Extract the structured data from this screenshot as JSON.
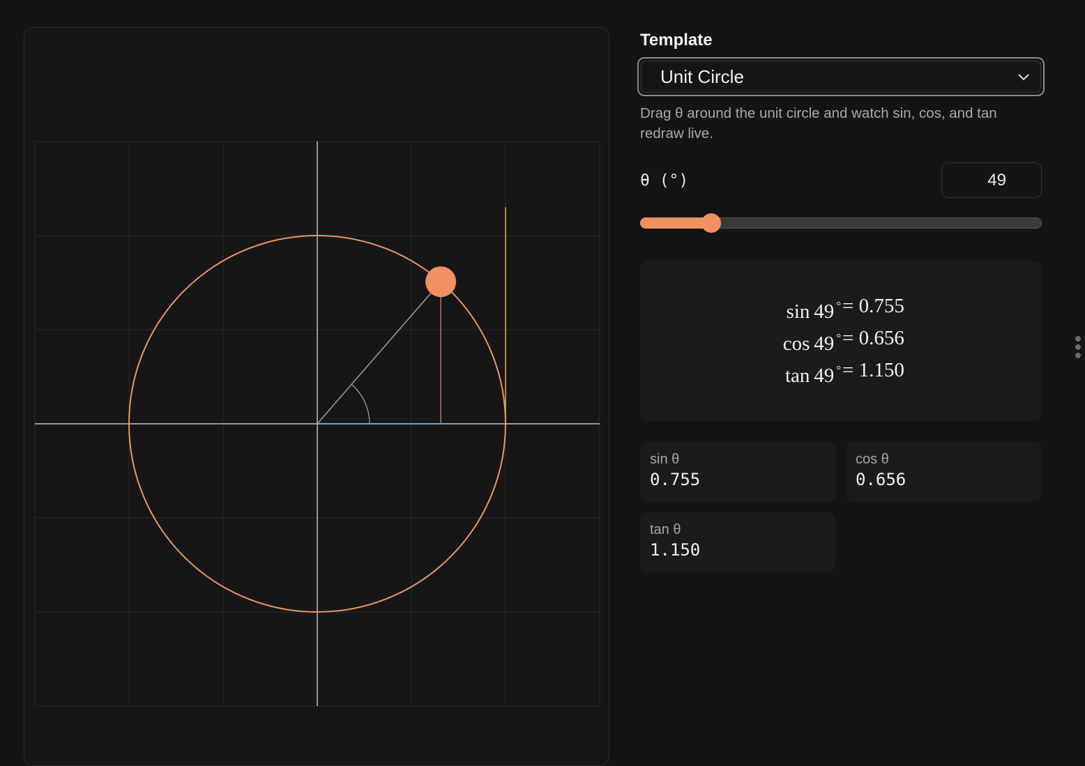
{
  "template": {
    "label": "Template",
    "selected": "Unit Circle",
    "description": "Drag θ around the unit circle and watch sin, cos, and tan redraw live."
  },
  "theta": {
    "label": "θ (°)",
    "value": "49",
    "degrees": 49,
    "slider_min": 0,
    "slider_max": 360
  },
  "formula": {
    "rows": [
      {
        "fn": "sin",
        "arg": "49",
        "deg": "°",
        "eq": "= 0.755"
      },
      {
        "fn": "cos",
        "arg": "49",
        "deg": "°",
        "eq": "= 0.656"
      },
      {
        "fn": "tan",
        "arg": "49",
        "deg": "°",
        "eq": "= 1.150"
      }
    ]
  },
  "cards": {
    "sin": {
      "label": "sin θ",
      "value": "0.755"
    },
    "cos": {
      "label": "cos θ",
      "value": "0.656"
    },
    "tan": {
      "label": "tan θ",
      "value": "1.150"
    }
  },
  "colors": {
    "accent": "#f0915f",
    "circle": "#ec9463",
    "sin_line": "#c2706a",
    "cos_line": "#6aa0d8",
    "tan_line": "#e0b040",
    "axis": "#bdbdbd",
    "grid": "#2a2a2a",
    "radius": "#9e9e9e"
  },
  "icons": {
    "dropdown": "chevron-down-icon",
    "menu": "kebab-menu-icon"
  }
}
